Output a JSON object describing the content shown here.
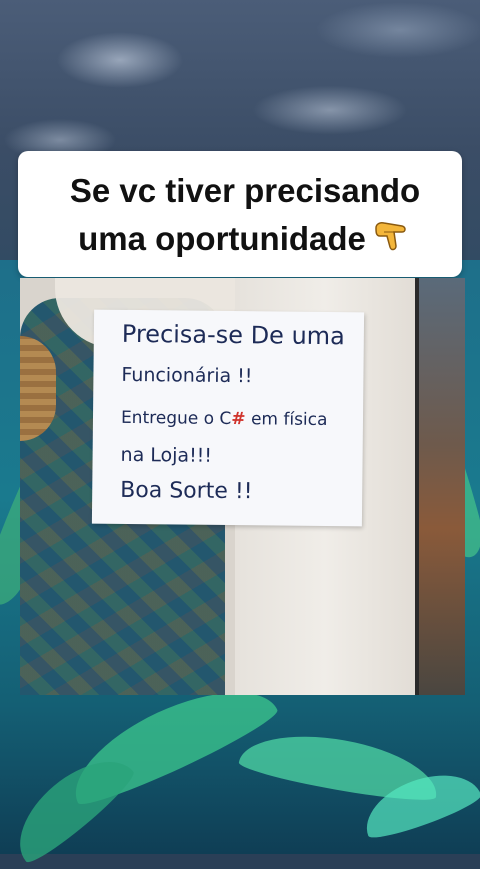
{
  "caption": {
    "line1": "Se vc tiver precisando",
    "line2": "uma oportunidade",
    "emoji_icon": "backhand-index-pointing-down"
  },
  "sign": {
    "line1": "Precisa-se De uma",
    "line2": "Funcionária !!",
    "line3_before": "Entregue o C",
    "line3_hash": "#",
    "line3_after": " em física",
    "line4": "na Loja!!!",
    "line5": "Boa Sorte !!"
  }
}
